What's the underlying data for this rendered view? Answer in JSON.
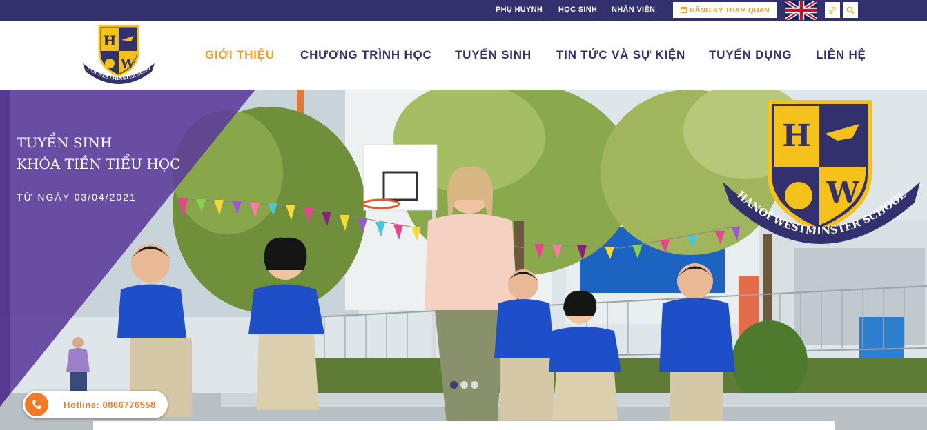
{
  "topbar": {
    "links": [
      "PHỤ HUYNH",
      "HỌC SINH",
      "NHÂN VIÊN"
    ],
    "visit_button": "ĐĂNG KÝ THAM QUAN",
    "language_icon": "uk-flag-icon",
    "link_icon": "link-icon",
    "search_icon": "search-icon"
  },
  "logo": {
    "letters": [
      "H",
      "W"
    ],
    "ribbon_text": "HANOI WESTMINSTER SCHOOL"
  },
  "nav": {
    "items": [
      "GIỚI THIỆU",
      "CHƯƠNG TRÌNH HỌC",
      "TUYỂN SINH",
      "TIN TỨC VÀ SỰ KIỆN",
      "TUYỂN DỤNG",
      "LIÊN HỆ"
    ],
    "active_index": 0
  },
  "hero": {
    "promo_line1": "TUYỂN SINH",
    "promo_line2": "KHÓA TIỀN TIỂU HỌC",
    "promo_date": "TỪ NGÀY 03/04/2021",
    "slide_count": 3,
    "active_slide": 0
  },
  "hotline": {
    "text": "Hotline: 0866776558"
  },
  "colors": {
    "brand_navy": "#33306e",
    "accent_orange": "#f0a030",
    "hotline_orange": "#f07a25",
    "promo_purple": "#5b3a9a",
    "uniform_blue": "#1f4fc8",
    "shield_gold": "#f5c11b"
  }
}
